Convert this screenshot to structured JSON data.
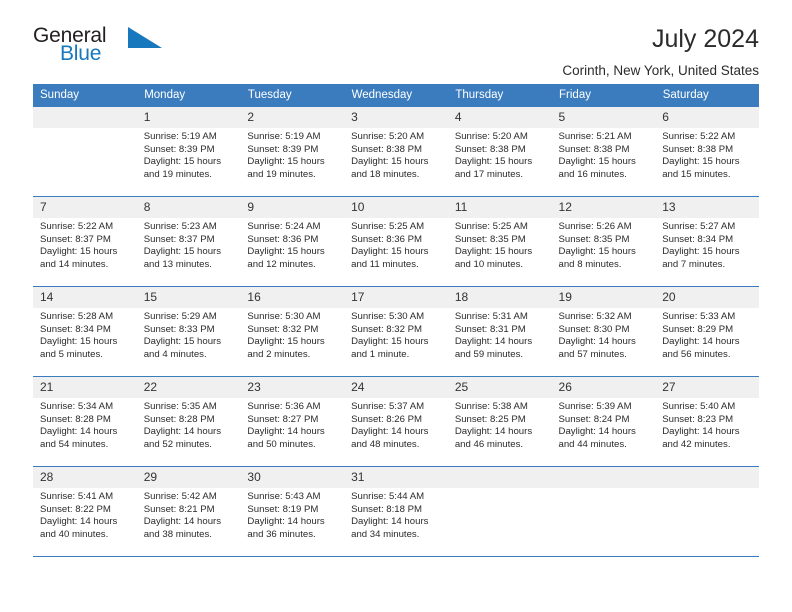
{
  "brand": {
    "name_top": "General",
    "name_bottom": "Blue",
    "triangle_color": "#1878be",
    "icon": "triangle-logo-icon"
  },
  "header": {
    "title": "July 2024",
    "subtitle": "Corinth, New York, United States"
  },
  "colors": {
    "header_blue": "#3a7cbe",
    "daynum_band": "#f0f0f0",
    "text": "#2b2b2b",
    "brand_blue": "#1878be"
  },
  "weekdays": [
    "Sunday",
    "Monday",
    "Tuesday",
    "Wednesday",
    "Thursday",
    "Friday",
    "Saturday"
  ],
  "labels": {
    "sunrise_prefix": "Sunrise: ",
    "sunset_prefix": "Sunset: ",
    "daylight_prefix": "Daylight: "
  },
  "weeks": [
    [
      {
        "empty": true
      },
      {
        "day": "1",
        "sunrise": "Sunrise: 5:19 AM",
        "sunset": "Sunset: 8:39 PM",
        "daylight_1": "Daylight: 15 hours",
        "daylight_2": "and 19 minutes."
      },
      {
        "day": "2",
        "sunrise": "Sunrise: 5:19 AM",
        "sunset": "Sunset: 8:39 PM",
        "daylight_1": "Daylight: 15 hours",
        "daylight_2": "and 19 minutes."
      },
      {
        "day": "3",
        "sunrise": "Sunrise: 5:20 AM",
        "sunset": "Sunset: 8:38 PM",
        "daylight_1": "Daylight: 15 hours",
        "daylight_2": "and 18 minutes."
      },
      {
        "day": "4",
        "sunrise": "Sunrise: 5:20 AM",
        "sunset": "Sunset: 8:38 PM",
        "daylight_1": "Daylight: 15 hours",
        "daylight_2": "and 17 minutes."
      },
      {
        "day": "5",
        "sunrise": "Sunrise: 5:21 AM",
        "sunset": "Sunset: 8:38 PM",
        "daylight_1": "Daylight: 15 hours",
        "daylight_2": "and 16 minutes."
      },
      {
        "day": "6",
        "sunrise": "Sunrise: 5:22 AM",
        "sunset": "Sunset: 8:38 PM",
        "daylight_1": "Daylight: 15 hours",
        "daylight_2": "and 15 minutes."
      }
    ],
    [
      {
        "day": "7",
        "sunrise": "Sunrise: 5:22 AM",
        "sunset": "Sunset: 8:37 PM",
        "daylight_1": "Daylight: 15 hours",
        "daylight_2": "and 14 minutes."
      },
      {
        "day": "8",
        "sunrise": "Sunrise: 5:23 AM",
        "sunset": "Sunset: 8:37 PM",
        "daylight_1": "Daylight: 15 hours",
        "daylight_2": "and 13 minutes."
      },
      {
        "day": "9",
        "sunrise": "Sunrise: 5:24 AM",
        "sunset": "Sunset: 8:36 PM",
        "daylight_1": "Daylight: 15 hours",
        "daylight_2": "and 12 minutes."
      },
      {
        "day": "10",
        "sunrise": "Sunrise: 5:25 AM",
        "sunset": "Sunset: 8:36 PM",
        "daylight_1": "Daylight: 15 hours",
        "daylight_2": "and 11 minutes."
      },
      {
        "day": "11",
        "sunrise": "Sunrise: 5:25 AM",
        "sunset": "Sunset: 8:35 PM",
        "daylight_1": "Daylight: 15 hours",
        "daylight_2": "and 10 minutes."
      },
      {
        "day": "12",
        "sunrise": "Sunrise: 5:26 AM",
        "sunset": "Sunset: 8:35 PM",
        "daylight_1": "Daylight: 15 hours",
        "daylight_2": "and 8 minutes."
      },
      {
        "day": "13",
        "sunrise": "Sunrise: 5:27 AM",
        "sunset": "Sunset: 8:34 PM",
        "daylight_1": "Daylight: 15 hours",
        "daylight_2": "and 7 minutes."
      }
    ],
    [
      {
        "day": "14",
        "sunrise": "Sunrise: 5:28 AM",
        "sunset": "Sunset: 8:34 PM",
        "daylight_1": "Daylight: 15 hours",
        "daylight_2": "and 5 minutes."
      },
      {
        "day": "15",
        "sunrise": "Sunrise: 5:29 AM",
        "sunset": "Sunset: 8:33 PM",
        "daylight_1": "Daylight: 15 hours",
        "daylight_2": "and 4 minutes."
      },
      {
        "day": "16",
        "sunrise": "Sunrise: 5:30 AM",
        "sunset": "Sunset: 8:32 PM",
        "daylight_1": "Daylight: 15 hours",
        "daylight_2": "and 2 minutes."
      },
      {
        "day": "17",
        "sunrise": "Sunrise: 5:30 AM",
        "sunset": "Sunset: 8:32 PM",
        "daylight_1": "Daylight: 15 hours",
        "daylight_2": "and 1 minute."
      },
      {
        "day": "18",
        "sunrise": "Sunrise: 5:31 AM",
        "sunset": "Sunset: 8:31 PM",
        "daylight_1": "Daylight: 14 hours",
        "daylight_2": "and 59 minutes."
      },
      {
        "day": "19",
        "sunrise": "Sunrise: 5:32 AM",
        "sunset": "Sunset: 8:30 PM",
        "daylight_1": "Daylight: 14 hours",
        "daylight_2": "and 57 minutes."
      },
      {
        "day": "20",
        "sunrise": "Sunrise: 5:33 AM",
        "sunset": "Sunset: 8:29 PM",
        "daylight_1": "Daylight: 14 hours",
        "daylight_2": "and 56 minutes."
      }
    ],
    [
      {
        "day": "21",
        "sunrise": "Sunrise: 5:34 AM",
        "sunset": "Sunset: 8:28 PM",
        "daylight_1": "Daylight: 14 hours",
        "daylight_2": "and 54 minutes."
      },
      {
        "day": "22",
        "sunrise": "Sunrise: 5:35 AM",
        "sunset": "Sunset: 8:28 PM",
        "daylight_1": "Daylight: 14 hours",
        "daylight_2": "and 52 minutes."
      },
      {
        "day": "23",
        "sunrise": "Sunrise: 5:36 AM",
        "sunset": "Sunset: 8:27 PM",
        "daylight_1": "Daylight: 14 hours",
        "daylight_2": "and 50 minutes."
      },
      {
        "day": "24",
        "sunrise": "Sunrise: 5:37 AM",
        "sunset": "Sunset: 8:26 PM",
        "daylight_1": "Daylight: 14 hours",
        "daylight_2": "and 48 minutes."
      },
      {
        "day": "25",
        "sunrise": "Sunrise: 5:38 AM",
        "sunset": "Sunset: 8:25 PM",
        "daylight_1": "Daylight: 14 hours",
        "daylight_2": "and 46 minutes."
      },
      {
        "day": "26",
        "sunrise": "Sunrise: 5:39 AM",
        "sunset": "Sunset: 8:24 PM",
        "daylight_1": "Daylight: 14 hours",
        "daylight_2": "and 44 minutes."
      },
      {
        "day": "27",
        "sunrise": "Sunrise: 5:40 AM",
        "sunset": "Sunset: 8:23 PM",
        "daylight_1": "Daylight: 14 hours",
        "daylight_2": "and 42 minutes."
      }
    ],
    [
      {
        "day": "28",
        "sunrise": "Sunrise: 5:41 AM",
        "sunset": "Sunset: 8:22 PM",
        "daylight_1": "Daylight: 14 hours",
        "daylight_2": "and 40 minutes."
      },
      {
        "day": "29",
        "sunrise": "Sunrise: 5:42 AM",
        "sunset": "Sunset: 8:21 PM",
        "daylight_1": "Daylight: 14 hours",
        "daylight_2": "and 38 minutes."
      },
      {
        "day": "30",
        "sunrise": "Sunrise: 5:43 AM",
        "sunset": "Sunset: 8:19 PM",
        "daylight_1": "Daylight: 14 hours",
        "daylight_2": "and 36 minutes."
      },
      {
        "day": "31",
        "sunrise": "Sunrise: 5:44 AM",
        "sunset": "Sunset: 8:18 PM",
        "daylight_1": "Daylight: 14 hours",
        "daylight_2": "and 34 minutes."
      },
      {
        "empty": true
      },
      {
        "empty": true
      },
      {
        "empty": true
      }
    ]
  ]
}
